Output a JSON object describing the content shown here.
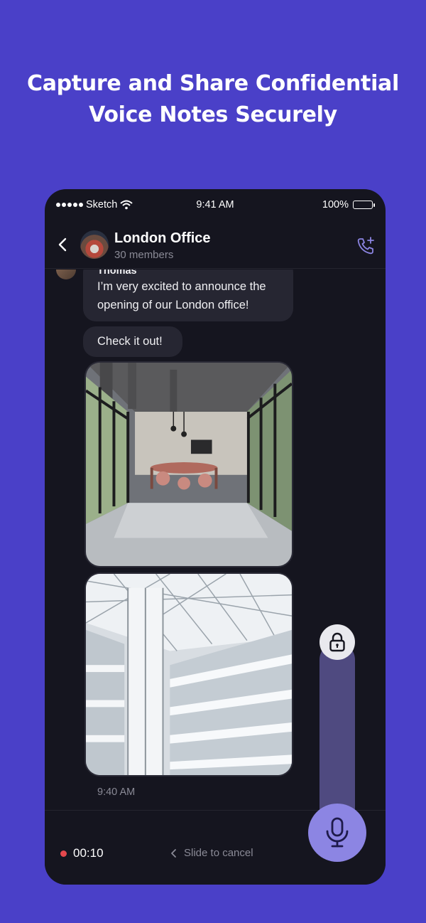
{
  "promo": {
    "headline_line1": "Capture and Share Confidential",
    "headline_line2": "Voice Notes Securely"
  },
  "status_bar": {
    "carrier": "Sketch",
    "time": "9:41 AM",
    "battery": "100%"
  },
  "chat_header": {
    "title": "London Office",
    "subtitle": "30 members"
  },
  "messages": [
    {
      "sender": "Thomas",
      "text": "I’m very excited to announce the opening of our London office!"
    },
    {
      "text": "Check it out!"
    }
  ],
  "attachments": [
    "office-interior-photo",
    "atrium-photo"
  ],
  "message_time": "9:40 AM",
  "recording": {
    "elapsed": "00:10",
    "hint": "Slide to cancel"
  },
  "icons": {
    "back": "chevron-left-icon",
    "add_call": "phone-add-icon",
    "lock": "lock-icon",
    "mic": "microphone-icon",
    "record": "recording-dot-icon"
  },
  "colors": {
    "background": "#4a40c8",
    "phone": "#15151f",
    "bubble": "#262632",
    "accent": "#8c85e3",
    "lock_track": "#4f4a80",
    "recording_dot": "#e5484d"
  }
}
